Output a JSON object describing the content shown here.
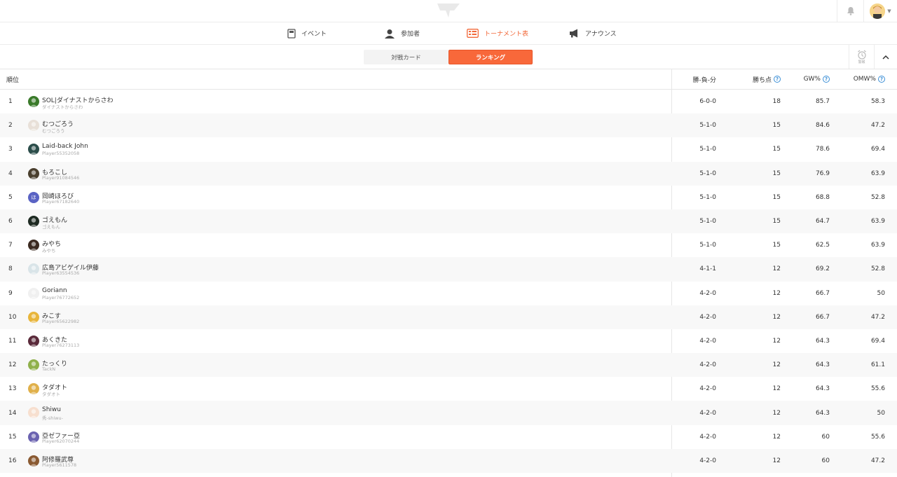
{
  "nav": {
    "tabs": [
      {
        "label": "イベント",
        "icon": "document-icon",
        "active": false
      },
      {
        "label": "参加者",
        "icon": "person-icon",
        "active": false
      },
      {
        "label": "トーナメント表",
        "icon": "bracket-icon",
        "active": true
      },
      {
        "label": "アナウンス",
        "icon": "megaphone-icon",
        "active": false
      }
    ]
  },
  "subtabs": {
    "match_card": "対戦カード",
    "ranking": "ランキング",
    "alarm_label": "警報"
  },
  "table": {
    "headers": {
      "rank": "順位",
      "record": "勝-負-分",
      "points": "勝ち点",
      "gw": "GW%",
      "omw": "OMW%"
    },
    "rows": [
      {
        "rank": "1",
        "name": "SOL|ダイナストからさわ",
        "sub": "ダイナストからさわ",
        "record": "6-0-0",
        "points": "18",
        "gw": "85.7",
        "omw": "58.3",
        "avatar_color": "#3a7a2a"
      },
      {
        "rank": "2",
        "name": "むつごろう",
        "sub": "むつごろう",
        "record": "5-1-0",
        "points": "15",
        "gw": "84.6",
        "omw": "47.2",
        "avatar_color": "#e8e0d8"
      },
      {
        "rank": "3",
        "name": "Laid-back John",
        "sub": "Player55352058",
        "record": "5-1-0",
        "points": "15",
        "gw": "78.6",
        "omw": "69.4",
        "avatar_color": "#2b4d4a"
      },
      {
        "rank": "4",
        "name": "もろこし",
        "sub": "Player91084546",
        "record": "5-1-0",
        "points": "15",
        "gw": "76.9",
        "omw": "63.9",
        "avatar_color": "#4a3f2e"
      },
      {
        "rank": "5",
        "name": "岡崎ほろび",
        "sub": "Player67182640",
        "record": "5-1-0",
        "points": "15",
        "gw": "68.8",
        "omw": "52.8",
        "avatar_color": "#5a63c4",
        "avatar_letter": "ほ"
      },
      {
        "rank": "6",
        "name": "ゴえもん",
        "sub": "ゴえもん",
        "record": "5-1-0",
        "points": "15",
        "gw": "64.7",
        "omw": "63.9",
        "avatar_color": "#1e2a22"
      },
      {
        "rank": "7",
        "name": "みやち",
        "sub": "みやち",
        "record": "5-1-0",
        "points": "15",
        "gw": "62.5",
        "omw": "63.9",
        "avatar_color": "#3b2a20"
      },
      {
        "rank": "8",
        "name": "広島アビゲイル伊藤",
        "sub": "Player63554536",
        "record": "4-1-1",
        "points": "12",
        "gw": "69.2",
        "omw": "52.8",
        "avatar_color": "#d9e4e8"
      },
      {
        "rank": "9",
        "name": "Goriann",
        "sub": "Player76772652",
        "record": "4-2-0",
        "points": "12",
        "gw": "66.7",
        "omw": "50",
        "avatar_color": "#f0f0f0"
      },
      {
        "rank": "10",
        "name": "みこす",
        "sub": "Player65622982",
        "record": "4-2-0",
        "points": "12",
        "gw": "66.7",
        "omw": "47.2",
        "avatar_color": "#e8b53a"
      },
      {
        "rank": "11",
        "name": "あくきた",
        "sub": "Player76273113",
        "record": "4-2-0",
        "points": "12",
        "gw": "64.3",
        "omw": "69.4",
        "avatar_color": "#5a2a3a"
      },
      {
        "rank": "12",
        "name": "たっくり",
        "sub": "TackN",
        "record": "4-2-0",
        "points": "12",
        "gw": "64.3",
        "omw": "61.1",
        "avatar_color": "#8fb04a"
      },
      {
        "rank": "13",
        "name": "タダオト",
        "sub": "タダオト",
        "record": "4-2-0",
        "points": "12",
        "gw": "64.3",
        "omw": "55.6",
        "avatar_color": "#e0b04a"
      },
      {
        "rank": "14",
        "name": "Shiwu",
        "sub": "秀-shiwu-",
        "record": "4-2-0",
        "points": "12",
        "gw": "64.3",
        "omw": "50",
        "avatar_color": "#f7dfcf"
      },
      {
        "rank": "15",
        "name": "亞ゼファー亞",
        "sub": "Player62070244",
        "record": "4-2-0",
        "points": "12",
        "gw": "60",
        "omw": "55.6",
        "avatar_color": "#6a62b0"
      },
      {
        "rank": "16",
        "name": "阿修羅武尊",
        "sub": "Player5611578",
        "record": "4-2-0",
        "points": "12",
        "gw": "60",
        "omw": "47.2",
        "avatar_color": "#8a5a32"
      }
    ]
  },
  "colors": {
    "accent": "#f8683a",
    "help_blue": "#3b8fd6"
  }
}
